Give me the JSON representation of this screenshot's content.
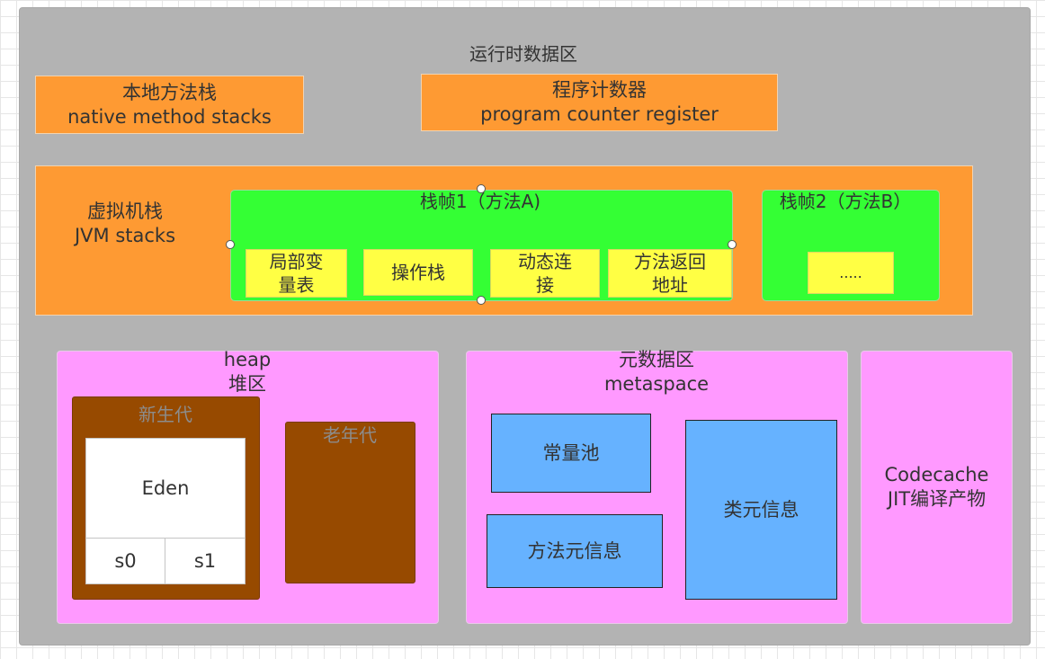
{
  "runtime_area": {
    "title": "运行时数据区"
  },
  "native_stack": {
    "line1": "本地方法栈",
    "line2": "native method stacks"
  },
  "pc_register": {
    "line1": "程序计数器",
    "line2": "program counter register"
  },
  "jvm_stack": {
    "line1": "虚拟机栈",
    "line2": "JVM stacks",
    "frame1": {
      "title": "栈帧1（方法A)",
      "cells": [
        {
          "line1": "局部变",
          "line2": "量表"
        },
        {
          "line1": "操作栈",
          "line2": ""
        },
        {
          "line1": "动态连",
          "line2": "接"
        },
        {
          "line1": "方法返回",
          "line2": "地址"
        }
      ]
    },
    "frame2": {
      "title": "栈帧2（方法B）",
      "cell": "....."
    }
  },
  "heap": {
    "line1": "heap",
    "line2": "堆区",
    "young_gen": {
      "title": "新生代",
      "eden": "Eden",
      "s0": "s0",
      "s1": "s1"
    },
    "old_gen": {
      "title": "老年代"
    }
  },
  "metaspace": {
    "line1": "元数据区",
    "line2": "metaspace",
    "constant_pool": "常量池",
    "method_meta": "方法元信息",
    "class_meta": "类元信息"
  },
  "codecache": {
    "line1": "Codecache",
    "line2": "JIT编译产物"
  },
  "colors": {
    "canvas": "#b3b3b3",
    "orange": "#fe9a33",
    "green": "#34ff34",
    "yellow": "#ffff44",
    "pink": "#ff99ff",
    "brown": "#974a00",
    "blue": "#66b2ff"
  }
}
